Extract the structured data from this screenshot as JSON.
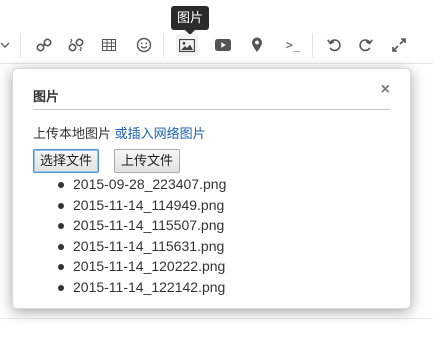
{
  "tooltip": "图片",
  "toolbar": {
    "items": [
      {
        "icon": "chevron-down-icon"
      },
      {
        "icon": "link-icon"
      },
      {
        "icon": "unlink-icon"
      },
      {
        "icon": "table-icon"
      },
      {
        "icon": "emoji-icon"
      },
      {
        "icon": "image-icon"
      },
      {
        "icon": "video-icon"
      },
      {
        "icon": "map-pin-icon"
      },
      {
        "icon": "code-icon",
        "label": ">_"
      },
      {
        "icon": "undo-icon"
      },
      {
        "icon": "redo-icon"
      },
      {
        "icon": "fullscreen-icon"
      }
    ]
  },
  "dialog": {
    "title": "图片",
    "close": "×",
    "upload_text": "上传本地图片",
    "insert_link": "或插入网络图片",
    "choose_button": "选择文件",
    "upload_button": "上传文件",
    "files": [
      "2015-09-28_223407.png",
      "2015-11-14_114949.png",
      "2015-11-14_115507.png",
      "2015-11-14_115631.png",
      "2015-11-14_120222.png",
      "2015-11-14_122142.png"
    ]
  }
}
